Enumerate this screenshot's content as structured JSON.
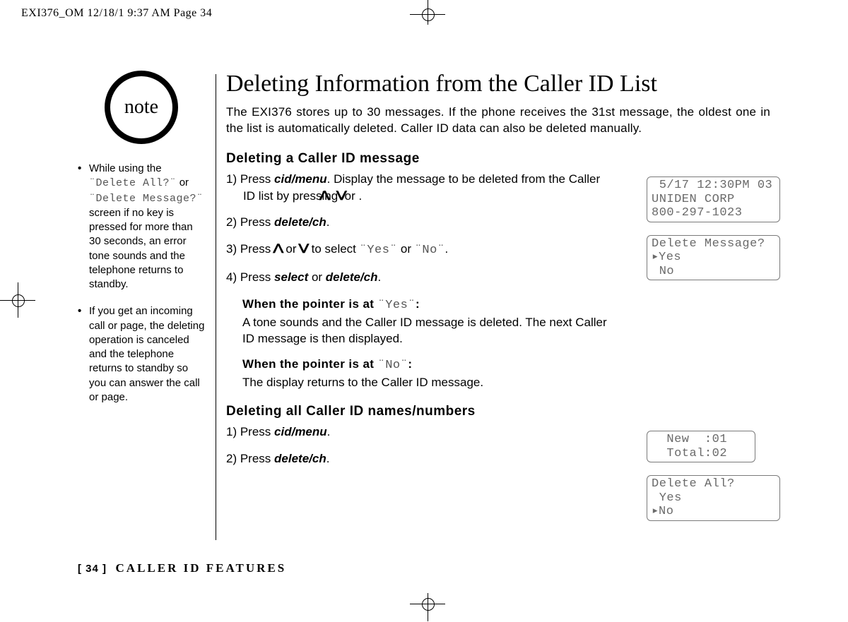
{
  "meta": {
    "header_strip": "EXI376_OM  12/18/1 9:37 AM  Page 34"
  },
  "note": {
    "badge": "note",
    "items": [
      {
        "pre": "While using the ",
        "lcd1": "¨Delete All?¨",
        "mid1": " or ",
        "lcd2": "¨Delete Message?¨",
        "post": " screen if no key is pressed for more than 30 seconds, an error tone sounds and the telephone returns to standby."
      },
      {
        "pre": "If you get an incoming call or page, the deleting operation is canceled and the telephone returns to standby so you can answer the call or page."
      }
    ]
  },
  "main": {
    "title": "Deleting Information from the Caller ID List",
    "intro": "The EXI376 stores up to 30 messages. If the phone receives the 31st message, the oldest one in the list is automatically deleted. Caller ID data can also be deleted manually.",
    "sectionA": {
      "heading": "Deleting a Caller ID message",
      "step1_a": "1) Press ",
      "step1_cmd1": "cid/menu",
      "step1_b": ". Display the message to be deleted from the Caller ID list by pressing ",
      "step1_c": " or ",
      "step1_d": ".",
      "step2_a": "2) Press ",
      "step2_cmd": "delete/ch",
      "step2_b": ".",
      "step3_a": "3) Press ",
      "step3_b": " or ",
      "step3_c": " to select ",
      "step3_yes": "¨Yes¨",
      "step3_d": " or ",
      "step3_no": "¨No¨",
      "step3_e": ".",
      "step4_a": "4) Press ",
      "step4_cmd1": "select",
      "step4_b": " or ",
      "step4_cmd2": "delete/ch",
      "step4_c": ".",
      "yes_lead_a": "When the pointer is at ",
      "yes_lead_lcd": "¨Yes¨",
      "yes_lead_b": ":",
      "yes_body": "A tone sounds and the Caller ID message is deleted. The next Caller ID message is then displayed.",
      "no_lead_a": "When the pointer is at ",
      "no_lead_lcd": "¨No¨",
      "no_lead_b": ":",
      "no_body": "The display returns to the Caller ID message."
    },
    "sectionB": {
      "heading": "Deleting all Caller ID names/numbers",
      "step1_a": "1) Press ",
      "step1_cmd": "cid/menu",
      "step1_b": ".",
      "step2_a": "2) Press ",
      "step2_cmd": "delete/ch",
      "step2_b": "."
    }
  },
  "screens": {
    "s1_l1": " 5/17 12:30PM 03",
    "s1_l2": "UNIDEN CORP",
    "s1_l3": "800-297-1023",
    "s2_l1": "Delete Message?",
    "s2_l2_ptr": "▸",
    "s2_l2": "Yes",
    "s2_l3": " No",
    "s3_l1": "  New  :01",
    "s3_l2": "  Total:02",
    "s4_l1": "Delete All?",
    "s4_l2": " Yes",
    "s4_l3_ptr": "▸",
    "s4_l3": "No"
  },
  "footer": {
    "page_num": "[ 34 ]",
    "title": "CALLER ID FEATURES"
  },
  "glyphs": {
    "up": "ᐱ",
    "down": "ᐯ"
  }
}
